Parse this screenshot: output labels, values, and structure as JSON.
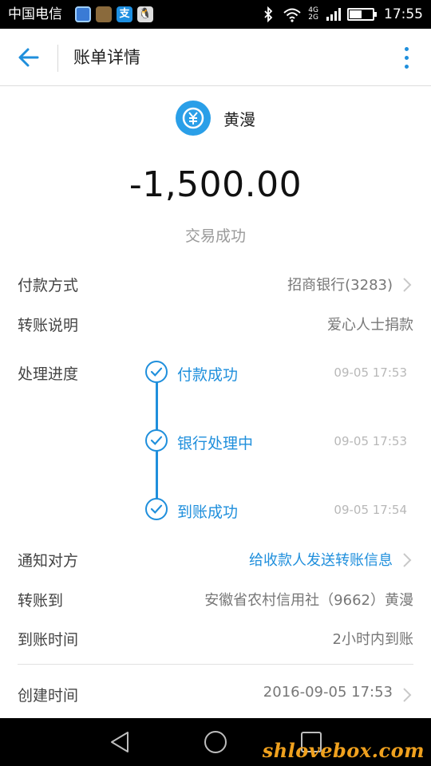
{
  "status_bar": {
    "carrier": "中国电信",
    "app_icons": [
      "cloud-app-icon",
      "box-app-icon",
      "alipay-app-icon",
      "qq-app-icon"
    ],
    "alipay_char": "支",
    "network_top": "4G",
    "network_bottom": "2G",
    "battery_level": 0.55,
    "time": "17:55"
  },
  "app_bar": {
    "title": "账单详情"
  },
  "payee": {
    "name": "黄漫",
    "avatar_color": "#2a9fe8"
  },
  "transaction": {
    "amount": "-1,500.00",
    "status": "交易成功"
  },
  "details": {
    "payment_method": {
      "label": "付款方式",
      "value": "招商银行(3283)"
    },
    "transfer_note": {
      "label": "转账说明",
      "value": "爱心人士捐款"
    },
    "progress": {
      "label": "处理进度",
      "steps": [
        {
          "label": "付款成功",
          "time": "09-05 17:53"
        },
        {
          "label": "银行处理中",
          "time": "09-05 17:53"
        },
        {
          "label": "到账成功",
          "time": "09-05 17:54"
        }
      ]
    },
    "notify": {
      "label": "通知对方",
      "value": "给收款人发送转账信息"
    },
    "transfer_to": {
      "label": "转账到",
      "value": "安徽省农村信用社（9662）黄漫"
    },
    "arrival_time": {
      "label": "到账时间",
      "value": "2小时内到账"
    },
    "created_time": {
      "label": "创建时间",
      "value": "2016-09-05 17:53"
    }
  },
  "watermark": "shlovebox.com",
  "colors": {
    "accent": "#1f8fdc",
    "status_bar_bg": "#000000",
    "nav_bar_bg": "#000000",
    "watermark": "#f0a11e"
  }
}
